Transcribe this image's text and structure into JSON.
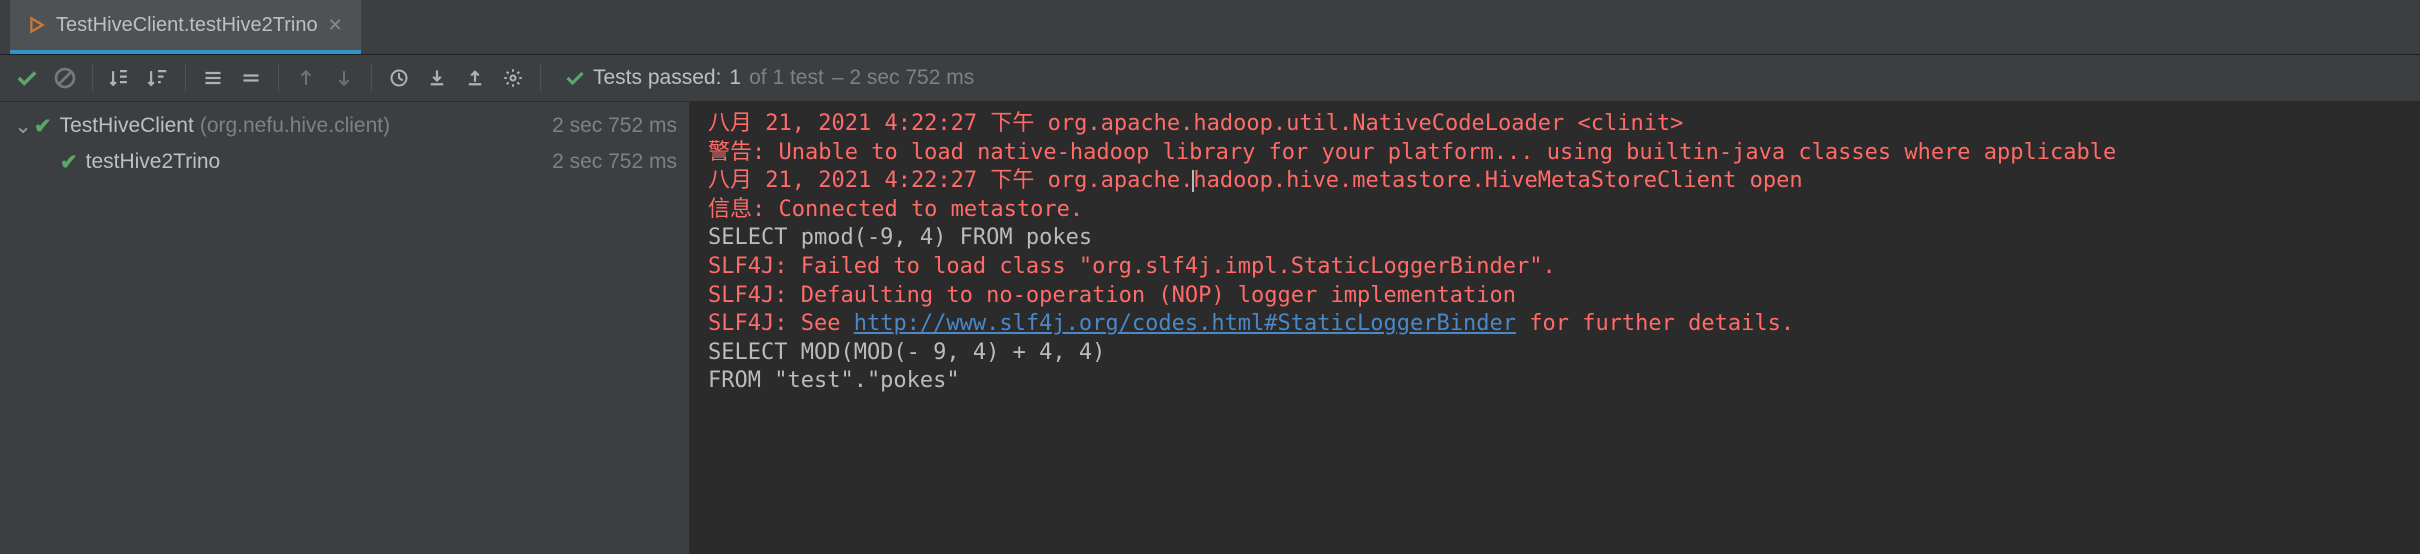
{
  "tab": {
    "title": "TestHiveClient.testHive2Trino"
  },
  "toolbar": {
    "summary_prefix": "Tests passed:",
    "summary_count": "1",
    "summary_total": "of 1 test",
    "summary_time": "– 2 sec 752 ms"
  },
  "tree": {
    "root_name": "TestHiveClient",
    "root_pkg": "(org.nefu.hive.client)",
    "root_time": "2 sec 752 ms",
    "child_name": "testHive2Trino",
    "child_time": "2 sec 752 ms"
  },
  "console": {
    "l1": "八月 21, 2021 4:22:27 下午 org.apache.hadoop.util.NativeCodeLoader <clinit>",
    "l2": "警告: Unable to load native-hadoop library for your platform... using builtin-java classes where applicable",
    "l3a": "八月 21, 2021 4:22:27 下午 org.apache.",
    "l3b": "hadoop.hive.metastore.HiveMetaStoreClient open",
    "l4": "信息: Connected to metastore.",
    "l5": "SELECT pmod(-9, 4) FROM pokes",
    "l6": "SLF4J: Failed to load class \"org.slf4j.impl.StaticLoggerBinder\".",
    "l7": "SLF4J: Defaulting to no-operation (NOP) logger implementation",
    "l8a": "SLF4J: See ",
    "l8_link": "http://www.slf4j.org/codes.html#StaticLoggerBinder",
    "l8b": " for further details.",
    "l9": "SELECT MOD(MOD(- 9, 4) + 4, 4)",
    "l10": "FROM \"test\".\"pokes\""
  }
}
